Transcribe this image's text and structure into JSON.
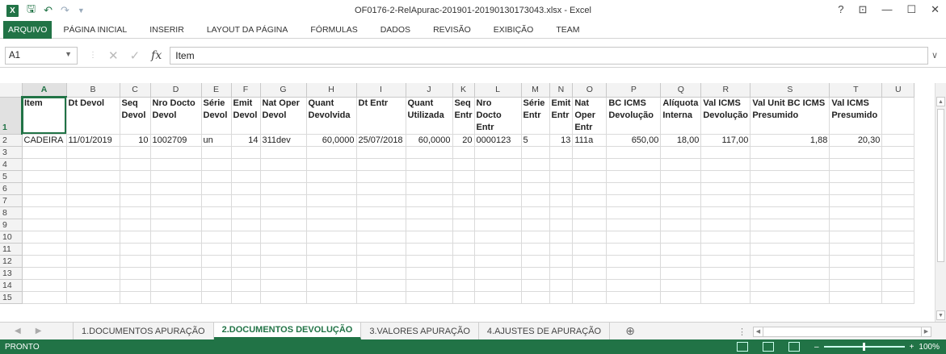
{
  "window": {
    "title": "OF0176-2-RelApurac-201901-20190130173043.xlsx - Excel",
    "app_icon": "X",
    "controls": [
      "?",
      "⊡",
      "—",
      "☐",
      "✕"
    ]
  },
  "ribbon": {
    "tabs": [
      "ARQUIVO",
      "PÁGINA INICIAL",
      "INSERIR",
      "LAYOUT DA PÁGINA",
      "FÓRMULAS",
      "DADOS",
      "REVISÃO",
      "EXIBIÇÃO",
      "TEAM"
    ]
  },
  "formula_bar": {
    "name_box": "A1",
    "content": "Item"
  },
  "columns": [
    "A",
    "B",
    "C",
    "D",
    "E",
    "F",
    "G",
    "H",
    "I",
    "J",
    "K",
    "L",
    "M",
    "N",
    "O",
    "P",
    "Q",
    "R",
    "S",
    "T",
    "U"
  ],
  "headers": [
    "Item",
    "Dt Devol",
    "Seq Devol",
    "Nro Docto Devol",
    "Série Devol",
    "Emit Devol",
    "Nat Oper Devol",
    "Quant Devolvida",
    "Dt Entr",
    "Quant Utilizada",
    "Seq Entr",
    "Nro Docto Entr",
    "Série Entr",
    "Emit Entr",
    "Nat Oper Entr",
    "BC ICMS Devolução",
    "Alíquota Interna",
    "Val ICMS Devolução",
    "Val Unit BC ICMS Presumido",
    "Val ICMS Presumido",
    ""
  ],
  "row2": [
    "CADEIRA",
    "11/01/2019",
    "10",
    "1002709",
    "un",
    "14",
    "311dev",
    "60,0000",
    "25/07/2018",
    "60,0000",
    "20",
    "0000123",
    "5",
    "13",
    "111a",
    "650,00",
    "18,00",
    "117,00",
    "1,88",
    "20,30",
    ""
  ],
  "row_numbers": [
    "1",
    "2",
    "3",
    "4",
    "5",
    "6",
    "7",
    "8",
    "9",
    "10",
    "11",
    "12",
    "13",
    "14",
    "15"
  ],
  "sheets": [
    "1.DOCUMENTOS APURAÇÃO",
    "2.DOCUMENTOS DEVOLUÇÃO",
    "3.VALORES APURAÇÃO",
    "4.AJUSTES DE APURAÇÃO"
  ],
  "active_sheet": "2.DOCUMENTOS DEVOLUÇÃO",
  "status": {
    "ready": "PRONTO",
    "zoom": "100%"
  },
  "colors": {
    "accent": "#217346"
  }
}
